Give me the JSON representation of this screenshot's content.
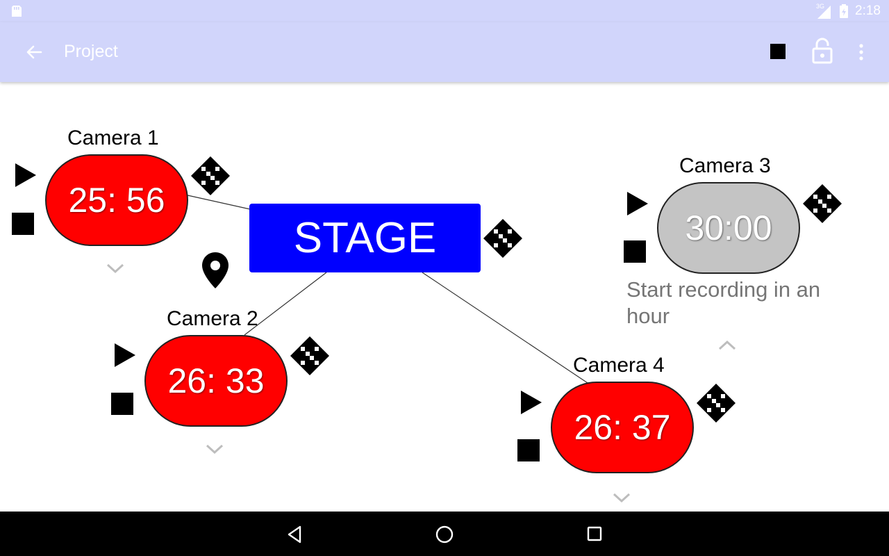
{
  "status_bar": {
    "time": "2:18",
    "network": "3G"
  },
  "app_bar": {
    "title": "Project"
  },
  "stage": {
    "label": "STAGE"
  },
  "cameras": [
    {
      "name": "Camera 1",
      "timer": "25: 56",
      "state": "recording",
      "color": "#ff0000"
    },
    {
      "name": "Camera 2",
      "timer": "26: 33",
      "state": "recording",
      "color": "#ff0000"
    },
    {
      "name": "Camera 3",
      "timer": "30:00",
      "state": "scheduled",
      "color": "#c4c4c4",
      "note": "Start recording in an hour"
    },
    {
      "name": "Camera 4",
      "timer": "26: 37",
      "state": "recording",
      "color": "#ff0000"
    }
  ],
  "icons": {
    "back": "arrow-back-icon",
    "stop_all": "stop-icon",
    "lock": "lock-open-icon",
    "overflow": "more-vert-icon",
    "play": "play-icon",
    "stop": "stop-icon",
    "move": "move-icon",
    "expand": "chevron-down-icon",
    "collapse": "chevron-up-icon",
    "location": "location-pin-icon",
    "nav_back": "nav-back-icon",
    "nav_home": "nav-home-icon",
    "nav_recents": "nav-recents-icon"
  },
  "colors": {
    "app_bar": "#d1d5fb",
    "stage": "#0000ff",
    "recording": "#ff0000",
    "idle": "#c4c4c4",
    "note_text": "#757575"
  }
}
